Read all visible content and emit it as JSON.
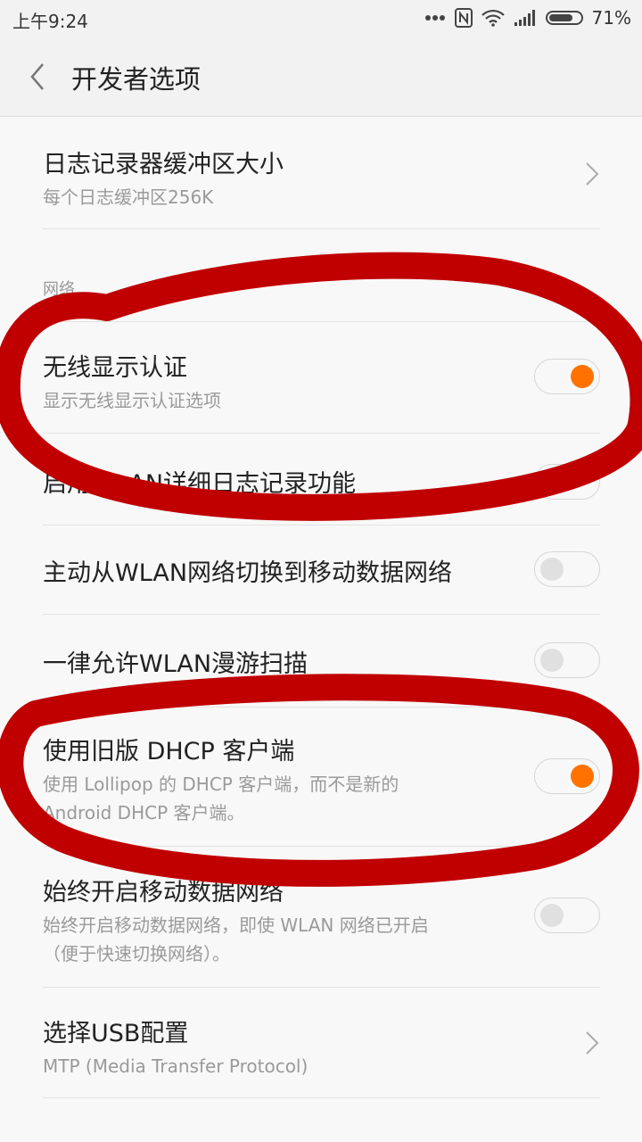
{
  "status": {
    "time": "上午9:24",
    "battery": "71%",
    "icons": [
      "more-dots-icon",
      "nfc-icon",
      "wifi-icon",
      "signal-icon",
      "battery-icon"
    ]
  },
  "header": {
    "back_icon": "chevron-left-icon",
    "title": "开发者选项"
  },
  "items": [
    {
      "title": "日志记录器缓冲区大小",
      "summary": "每个日志缓冲区256K",
      "control": "chevron"
    },
    {
      "section": "网络"
    },
    {
      "title": "无线显示认证",
      "summary": "显示无线显示认证选项",
      "control": "switch",
      "on": true
    },
    {
      "title": "启用WLAN详细日志记录功能",
      "control": "switch",
      "on": false
    },
    {
      "title": "主动从WLAN网络切换到移动数据网络",
      "control": "switch",
      "on": false
    },
    {
      "title": "一律允许WLAN漫游扫描",
      "control": "switch",
      "on": false
    },
    {
      "title": "使用旧版 DHCP 客户端",
      "summary_lines": [
        "使用 Lollipop 的 DHCP 客户端，而不是新的",
        "Android DHCP 客户端。"
      ],
      "control": "switch",
      "on": true
    },
    {
      "title": "始终开启移动数据网络",
      "summary_lines": [
        "始终开启移动数据网络，即使 WLAN 网络已开启",
        "（便于快速切换网络）。"
      ],
      "control": "switch",
      "on": false
    },
    {
      "title": "选择USB配置",
      "summary": "MTP (Media Transfer Protocol)",
      "control": "chevron"
    }
  ],
  "colors": {
    "accent": "#ff7200",
    "annotation": "#c00000",
    "background": "#f8f8f8",
    "header_bg": "#f2f2f2"
  }
}
